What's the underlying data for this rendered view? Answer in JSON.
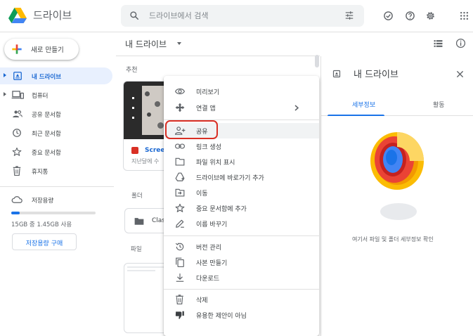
{
  "app": {
    "title": "드라이브"
  },
  "search": {
    "placeholder": "드라이브에서 검색"
  },
  "sidebar": {
    "new_label": "새로 만들기",
    "items": [
      {
        "label": "내 드라이브",
        "active": true
      },
      {
        "label": "컴퓨터"
      },
      {
        "label": "공유 문서함"
      },
      {
        "label": "최근 문서함"
      },
      {
        "label": "중요 문서함"
      },
      {
        "label": "휴지통"
      }
    ],
    "storage_label": "저장용량",
    "storage_text": "15GB 중 1.45GB 사용",
    "storage_fraction": 0.097,
    "buy_label": "저장용량 구매"
  },
  "main": {
    "title": "내 드라이브",
    "recommended": "추천",
    "file_name": "Screen",
    "file_sub": "지난달에 수",
    "folders_label": "폴더",
    "folder_name": "Clas",
    "files_label": "파일"
  },
  "details": {
    "title": "내 드라이브",
    "tab_details": "세부정보",
    "tab_activity": "활동",
    "hint": "여기서 파일 및 폴더 세부정보 확인"
  },
  "menu": {
    "items": [
      {
        "label": "미리보기",
        "icon": "eye-icon"
      },
      {
        "label": "연결 앱",
        "icon": "apps-icon",
        "submenu": true
      },
      {
        "label": "공유",
        "icon": "person-add-icon",
        "highlight": true
      },
      {
        "label": "링크 생성",
        "icon": "link-icon"
      },
      {
        "label": "파일 위치 표시",
        "icon": "folder-icon"
      },
      {
        "label": "드라이브에 바로가기 추가",
        "icon": "shortcut-icon"
      },
      {
        "label": "이동",
        "icon": "move-icon"
      },
      {
        "label": "중요 문서함에 추가",
        "icon": "star-icon"
      },
      {
        "label": "이름 바꾸기",
        "icon": "pencil-icon"
      },
      {
        "label": "버전 관리",
        "icon": "history-icon"
      },
      {
        "label": "사본 만들기",
        "icon": "copy-icon"
      },
      {
        "label": "다운로드",
        "icon": "download-icon"
      },
      {
        "label": "삭제",
        "icon": "trash-icon"
      },
      {
        "label": "유용한 제안이 아님",
        "icon": "thumb-down-icon"
      }
    ]
  },
  "colors": {
    "accent": "#1a73e8",
    "highlight_border": "#d93025",
    "active_bg": "#e8f0fe"
  }
}
